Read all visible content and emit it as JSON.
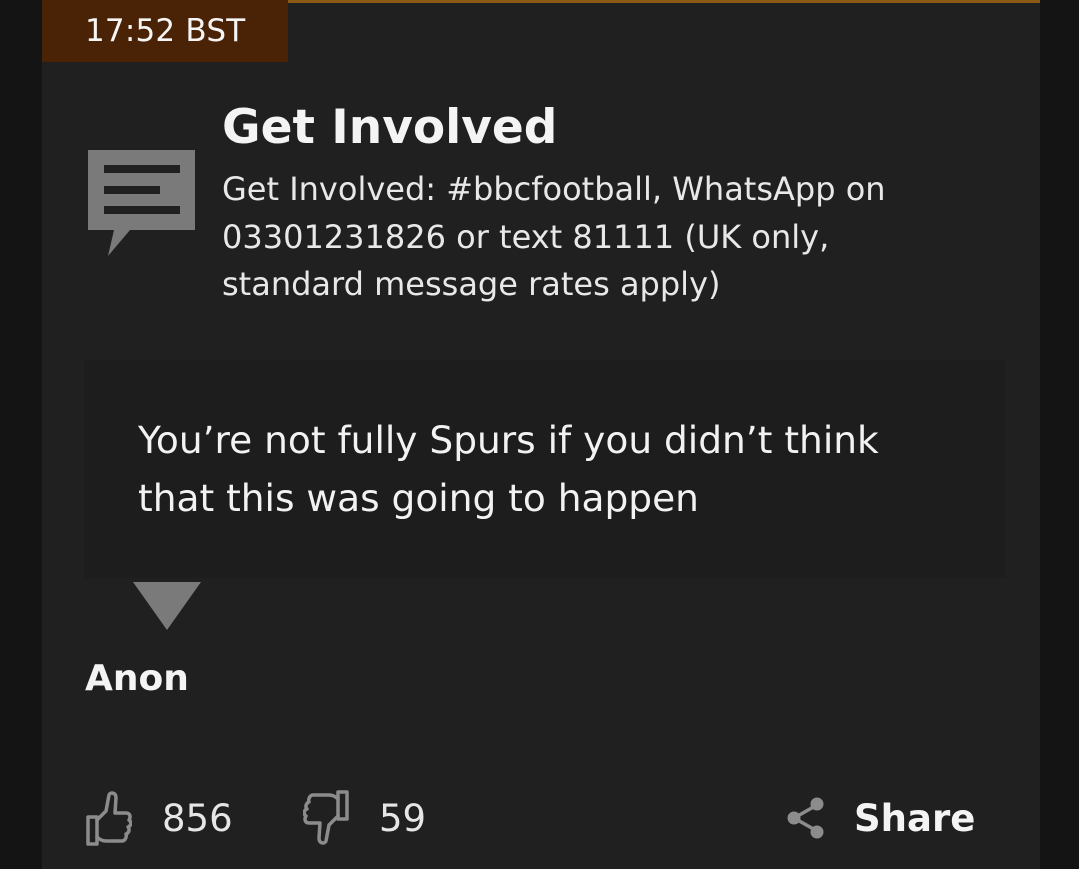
{
  "post": {
    "timestamp": "17:52 BST",
    "colors": {
      "timestamp_bg": "#4a2307",
      "accent_rule": "#8a5a14",
      "icon_grey": "#7a7a7a",
      "background": "#202020"
    }
  },
  "get_involved": {
    "icon": "chat-bubble-icon",
    "title": "Get Involved",
    "description": "Get Involved: #bbcfootball, WhatsApp on 03301231826 or text 81111 (UK only, standard message rates apply)"
  },
  "comment": {
    "quote": "You’re not fully Spurs if you didn’t think that this was going to happen",
    "author": "Anon"
  },
  "actions": {
    "like_count": "856",
    "dislike_count": "59",
    "share_label": "Share"
  }
}
